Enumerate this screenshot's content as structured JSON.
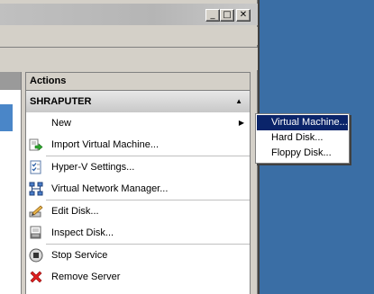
{
  "window": {
    "caption_buttons": {
      "minimize": "_",
      "maximize": "□",
      "close": "✕"
    }
  },
  "actions_pane": {
    "header": "Actions",
    "section": {
      "title": "SHRAPUTER",
      "collapse_icon": "up-triangle-icon"
    },
    "items": [
      {
        "label": "New",
        "icon": "none",
        "has_submenu": true
      },
      {
        "label": "Import Virtual Machine...",
        "icon": "import-vm-icon"
      },
      {
        "label": "Hyper-V Settings...",
        "icon": "settings-icon"
      },
      {
        "label": "Virtual Network Manager...",
        "icon": "network-icon"
      },
      {
        "label": "Edit Disk...",
        "icon": "edit-disk-icon"
      },
      {
        "label": "Inspect Disk...",
        "icon": "inspect-disk-icon"
      },
      {
        "label": "Stop Service",
        "icon": "stop-icon"
      },
      {
        "label": "Remove Server",
        "icon": "remove-icon"
      }
    ]
  },
  "submenu": {
    "items": [
      {
        "label": "Virtual Machine...",
        "highlighted": true
      },
      {
        "label": "Hard Disk...",
        "highlighted": false
      },
      {
        "label": "Floppy Disk...",
        "highlighted": false
      }
    ]
  },
  "colors": {
    "desktop": "#3a6ea5",
    "highlight": "#0a246a",
    "window_face": "#d4d0c8"
  }
}
